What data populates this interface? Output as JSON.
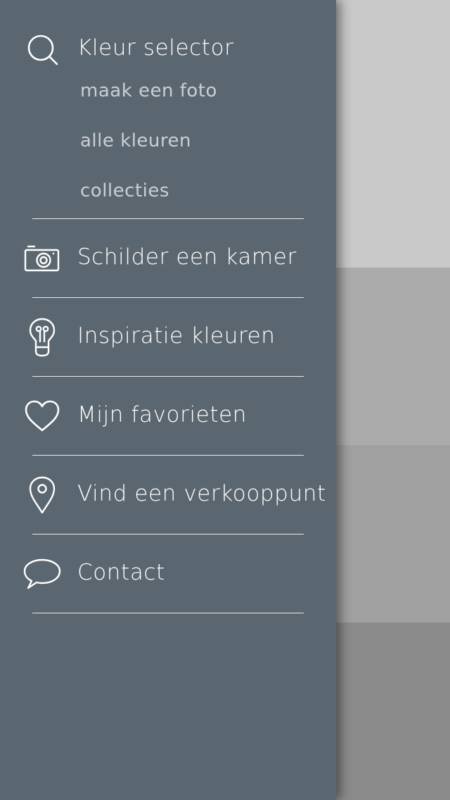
{
  "menu": {
    "color_selector": {
      "label": "Kleur selector",
      "icon": "search-icon",
      "sub_items": [
        {
          "label": "maak een foto"
        },
        {
          "label": "alle kleuren"
        },
        {
          "label": "collecties"
        }
      ]
    },
    "items": [
      {
        "label": "Schilder een kamer",
        "icon": "camera-icon"
      },
      {
        "label": "Inspiratie kleuren",
        "icon": "lightbulb-icon"
      },
      {
        "label": "Mijn favorieten",
        "icon": "heart-icon"
      },
      {
        "label": "Vind een verkooppunt",
        "icon": "map-pin-icon"
      },
      {
        "label": "Contact",
        "icon": "speech-bubble-icon"
      }
    ]
  },
  "colors": {
    "drawer_background": "#5b6770",
    "panel_colors": [
      "#c8c8c8",
      "#ababab",
      "#a0a0a0",
      "#8b8b8b"
    ]
  }
}
